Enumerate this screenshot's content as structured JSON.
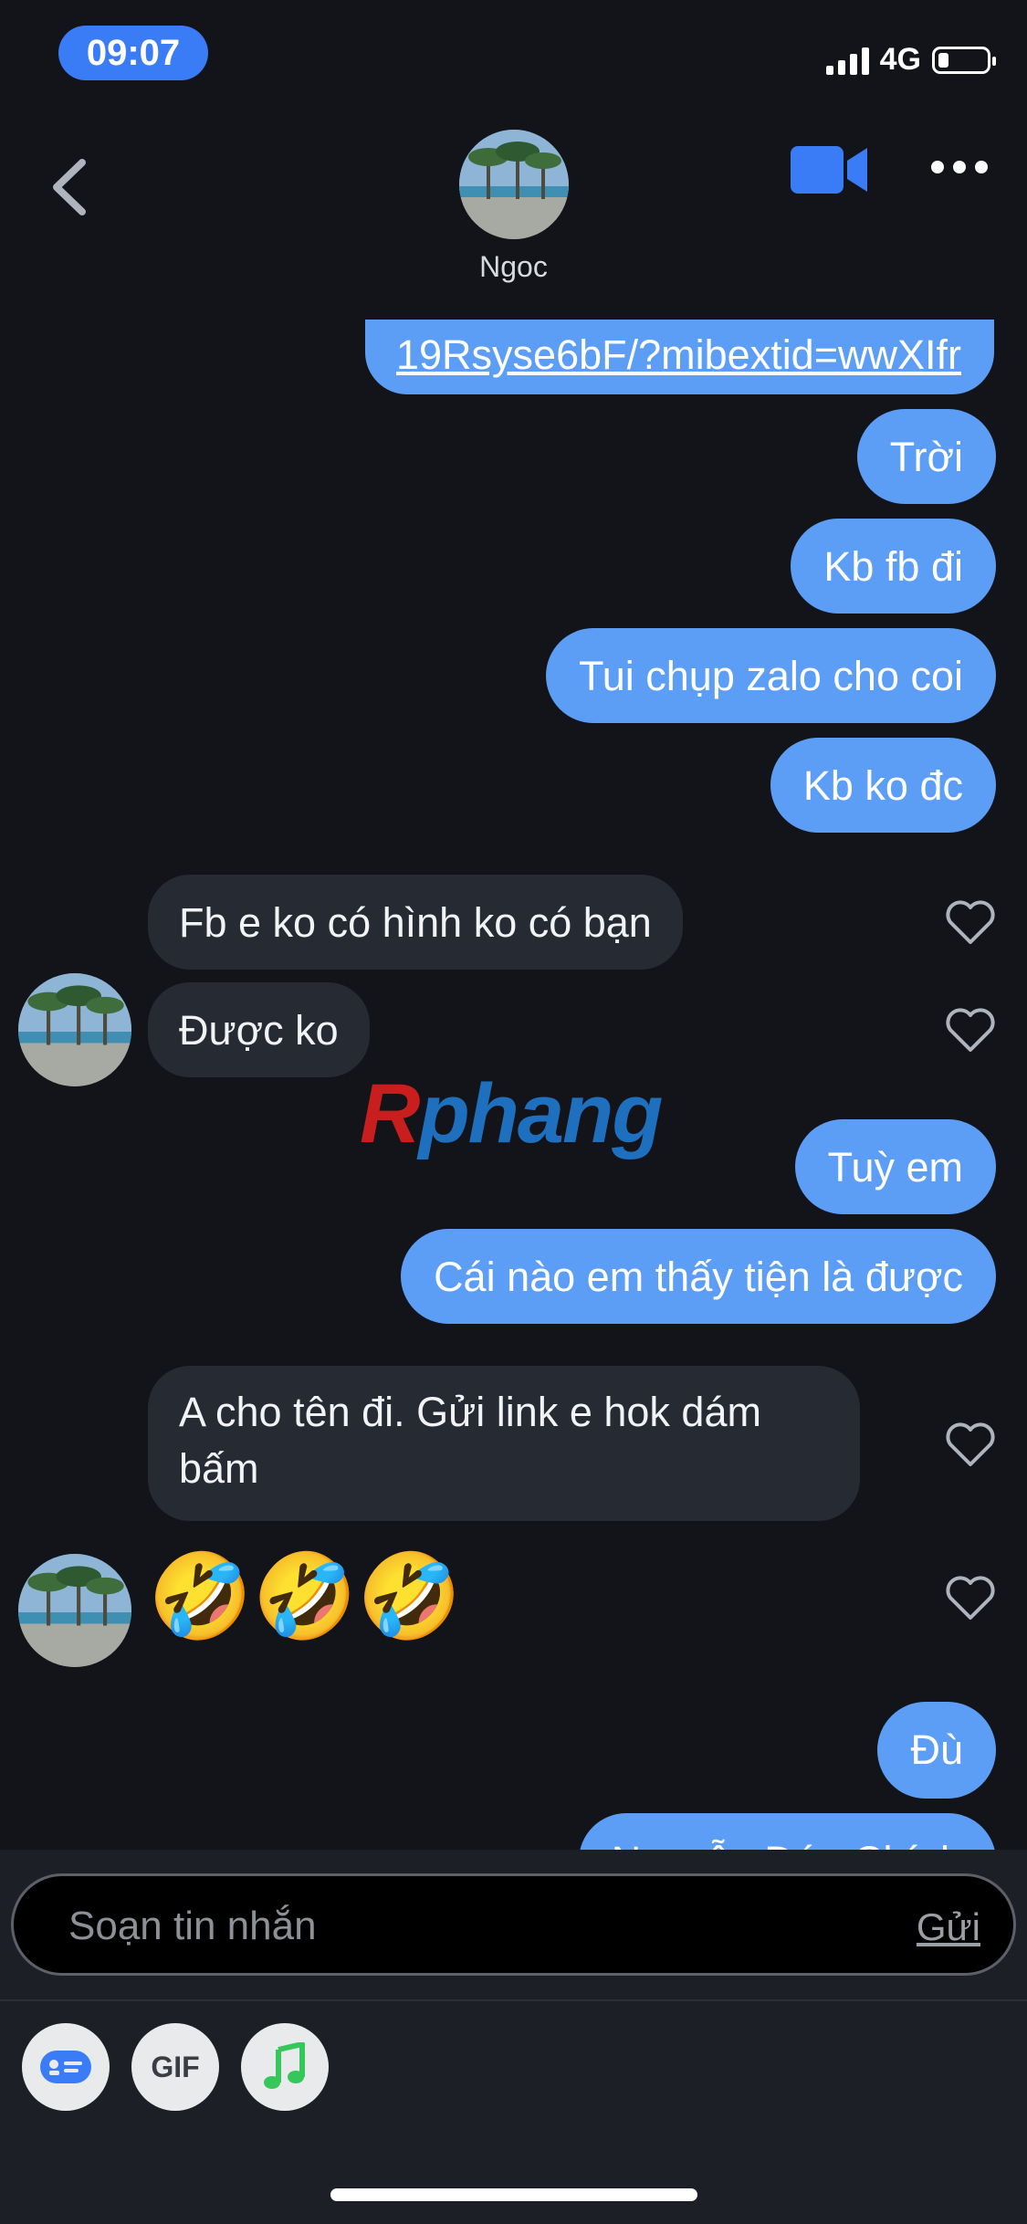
{
  "status_bar": {
    "time": "09:07",
    "network": "4G",
    "battery_level": 0.2
  },
  "header": {
    "contact_name": "Ngoc"
  },
  "messages": [
    {
      "side": "out",
      "text": "19Rsyse6bF/?mibextid=wwXIfr",
      "link": true
    },
    {
      "side": "out",
      "text": "Trời"
    },
    {
      "side": "out",
      "text": "Kb fb đi"
    },
    {
      "side": "out",
      "text": "Tui chụp zalo cho coi"
    },
    {
      "side": "out",
      "text": "Kb ko đc"
    },
    {
      "side": "in",
      "text": "Fb e ko có hình ko có bạn"
    },
    {
      "side": "in",
      "text": "Được ko"
    },
    {
      "side": "out",
      "text": "Tuỳ em"
    },
    {
      "side": "out",
      "text": "Cái nào em thấy tiện là được"
    },
    {
      "side": "in",
      "text": "A cho tên đi. Gửi link e hok dám bấm"
    },
    {
      "side": "in",
      "text": "🤣🤣🤣"
    },
    {
      "side": "out",
      "text": "Đù"
    },
    {
      "side": "out",
      "text": "Nguyễn Đức Chính"
    }
  ],
  "watermark": {
    "first": "R",
    "rest": "phang"
  },
  "composer": {
    "placeholder": "Soạn tin nhắn",
    "send_label": "Gửi"
  },
  "toolbar": {
    "gif_label": "GIF"
  },
  "colors": {
    "outgoing": "#5c9ef5",
    "incoming": "#262a33",
    "background": "#121419",
    "accent": "#3a7bf6"
  }
}
